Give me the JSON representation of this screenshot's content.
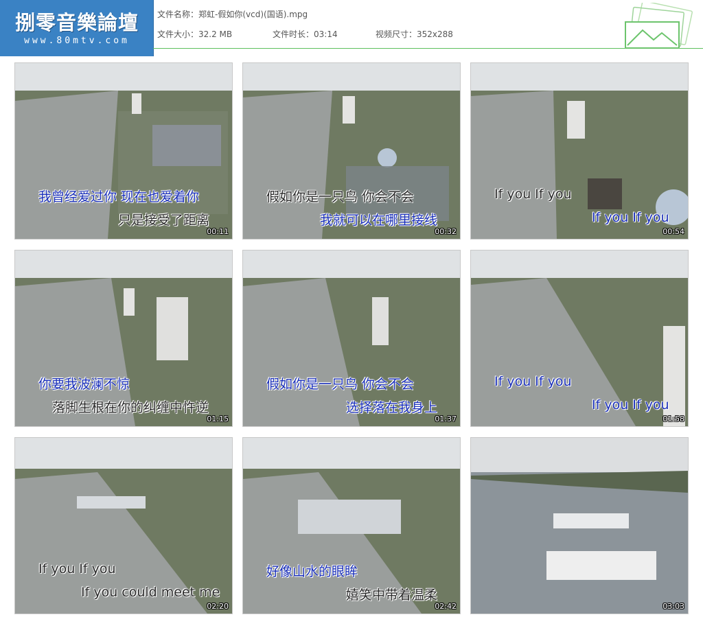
{
  "logo": {
    "title": "捌零音樂論壇",
    "url": "www.80mtv.com"
  },
  "file": {
    "name_label": "文件名称：",
    "name": "郑虹-假如你(vcd)(国语).mpg",
    "size_label": "文件大小：",
    "size": "32.2 MB",
    "duration_label": "文件时长：",
    "duration": "03:14",
    "dims_label": "视频尺寸：",
    "dims": "352x288"
  },
  "colors": {
    "logo_bg": "#3a82c4",
    "header_line": "#5cc05c",
    "sub_blue": "#1a2fb8"
  },
  "thumbnails": [
    {
      "time": "00:11",
      "line1": "我曾经爱过你 现在也爱着你",
      "line2": "只是接受了距离"
    },
    {
      "time": "00:32",
      "line1": "假如你是一只鸟 你会不会",
      "line2": "我就可以在哪里接线"
    },
    {
      "time": "00:54",
      "line1": "If you If you",
      "line2": "If you If you"
    },
    {
      "time": "01:15",
      "line1": "你要我波澜不惊",
      "line2": "落脚生根在你的纠缠中忤逆"
    },
    {
      "time": "01:37",
      "line1": "假如你是一只鸟 你会不会",
      "line2": "选择落在我身上"
    },
    {
      "time": "01:58",
      "line1": "If you If you",
      "line2": "If you If you"
    },
    {
      "time": "02:20",
      "line1": "If you If you",
      "line2": "If you could meet me"
    },
    {
      "time": "02:42",
      "line1": "好像山水的眼眸",
      "line2": "嬉笑中带着温柔"
    },
    {
      "time": "03:03",
      "line1": "",
      "line2": ""
    }
  ]
}
